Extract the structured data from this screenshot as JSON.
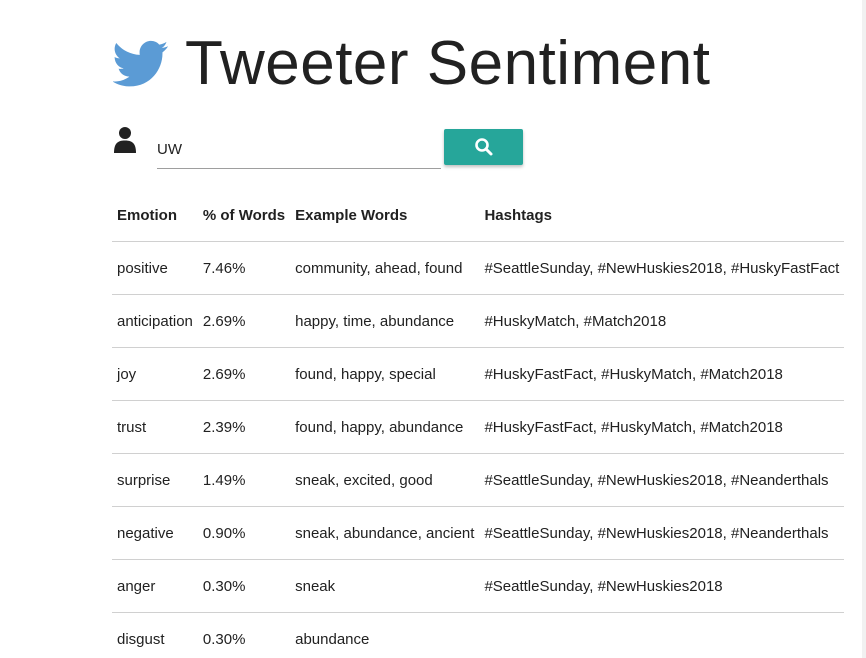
{
  "header": {
    "title": "Tweeter Sentiment",
    "logo_icon": "twitter-bird-icon",
    "logo_color": "#5b9bd5"
  },
  "search": {
    "user_icon": "user-icon",
    "value": "UW",
    "button_icon": "search-icon",
    "button_color": "#26a69a"
  },
  "table": {
    "headers": {
      "emotion": "Emotion",
      "percent": "% of Words",
      "examples": "Example Words",
      "hashtags": "Hashtags"
    },
    "rows": [
      {
        "emotion": "positive",
        "percent": "7.46%",
        "examples": "community, ahead, found",
        "hashtags": "#SeattleSunday, #NewHuskies2018, #HuskyFastFact"
      },
      {
        "emotion": "anticipation",
        "percent": "2.69%",
        "examples": "happy, time, abundance",
        "hashtags": "#HuskyMatch, #Match2018"
      },
      {
        "emotion": "joy",
        "percent": "2.69%",
        "examples": "found, happy, special",
        "hashtags": "#HuskyFastFact, #HuskyMatch, #Match2018"
      },
      {
        "emotion": "trust",
        "percent": "2.39%",
        "examples": "found, happy, abundance",
        "hashtags": "#HuskyFastFact, #HuskyMatch, #Match2018"
      },
      {
        "emotion": "surprise",
        "percent": "1.49%",
        "examples": "sneak, excited, good",
        "hashtags": "#SeattleSunday, #NewHuskies2018, #Neanderthals"
      },
      {
        "emotion": "negative",
        "percent": "0.90%",
        "examples": "sneak, abundance, ancient",
        "hashtags": "#SeattleSunday, #NewHuskies2018, #Neanderthals"
      },
      {
        "emotion": "anger",
        "percent": "0.30%",
        "examples": "sneak",
        "hashtags": "#SeattleSunday, #NewHuskies2018"
      },
      {
        "emotion": "disgust",
        "percent": "0.30%",
        "examples": "abundance",
        "hashtags": ""
      }
    ]
  }
}
